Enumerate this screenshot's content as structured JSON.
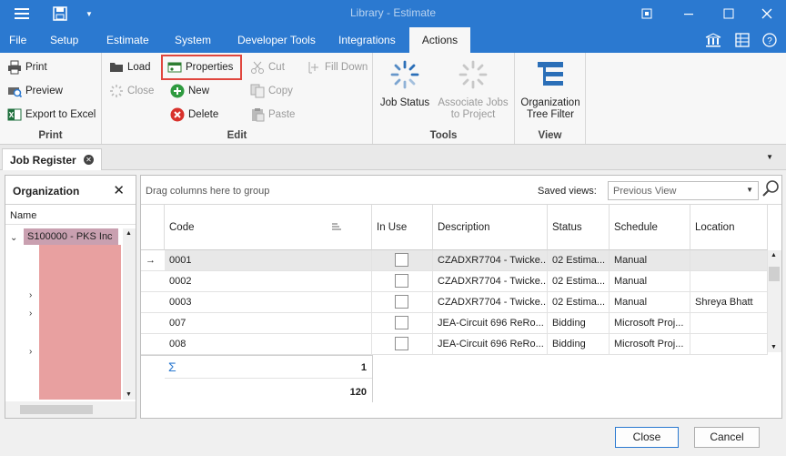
{
  "window": {
    "title": "Library - Estimate"
  },
  "menu": {
    "tabs": [
      "File",
      "Setup",
      "Estimate",
      "System",
      "Developer Tools",
      "Integrations",
      "Actions"
    ],
    "active_tab": "Actions"
  },
  "ribbon": {
    "print_group": {
      "label": "Print",
      "print": "Print",
      "preview": "Preview",
      "export": "Export to Excel"
    },
    "edit_group": {
      "label": "Edit",
      "load": "Load",
      "close": "Close",
      "properties": "Properties",
      "new": "New",
      "delete": "Delete",
      "cut": "Cut",
      "copy": "Copy",
      "paste": "Paste",
      "fill_down": "Fill Down"
    },
    "tools_group": {
      "label": "Tools",
      "job_status": "Job Status",
      "associate_jobs": "Associate Jobs to Project"
    },
    "view_group": {
      "label": "View",
      "org_tree_filter": "Organization Tree Filter"
    }
  },
  "doc_tab": {
    "label": "Job Register"
  },
  "org_panel": {
    "title": "Organization",
    "column": "Name",
    "root": "S100000 - PKS Inc"
  },
  "grid": {
    "group_hint": "Drag columns here to group",
    "saved_views_label": "Saved views:",
    "saved_views_value": "Previous View",
    "columns": [
      "Code",
      "In Use",
      "Description",
      "Status",
      "Schedule",
      "Location"
    ],
    "rows": [
      {
        "code": "0001",
        "description": "CZADXR7704 - Twicke...",
        "status": "02 Estima...",
        "schedule": "Manual",
        "location": ""
      },
      {
        "code": "0002",
        "description": "CZADXR7704 - Twicke...",
        "status": "02 Estima...",
        "schedule": "Manual",
        "location": ""
      },
      {
        "code": "0003",
        "description": "CZADXR7704 - Twicke...",
        "status": "02 Estima...",
        "schedule": "Manual",
        "location": "Shreya Bhatt"
      },
      {
        "code": "007",
        "description": "JEA-Circuit 696 ReRo...",
        "status": "Bidding",
        "schedule": "Microsoft Proj...",
        "location": ""
      },
      {
        "code": "008",
        "description": "JEA-Circuit 696 ReRo...",
        "status": "Bidding",
        "schedule": "Microsoft Proj...",
        "location": ""
      }
    ],
    "summary_symbol": "Σ",
    "summary_selected": "1",
    "summary_total": "120"
  },
  "buttons": {
    "close": "Close",
    "cancel": "Cancel"
  },
  "colors": {
    "accent": "#2b79d0",
    "highlight": "#e0463e",
    "redacted": "#e8a0a0",
    "root_bg": "#c9a0b0"
  }
}
